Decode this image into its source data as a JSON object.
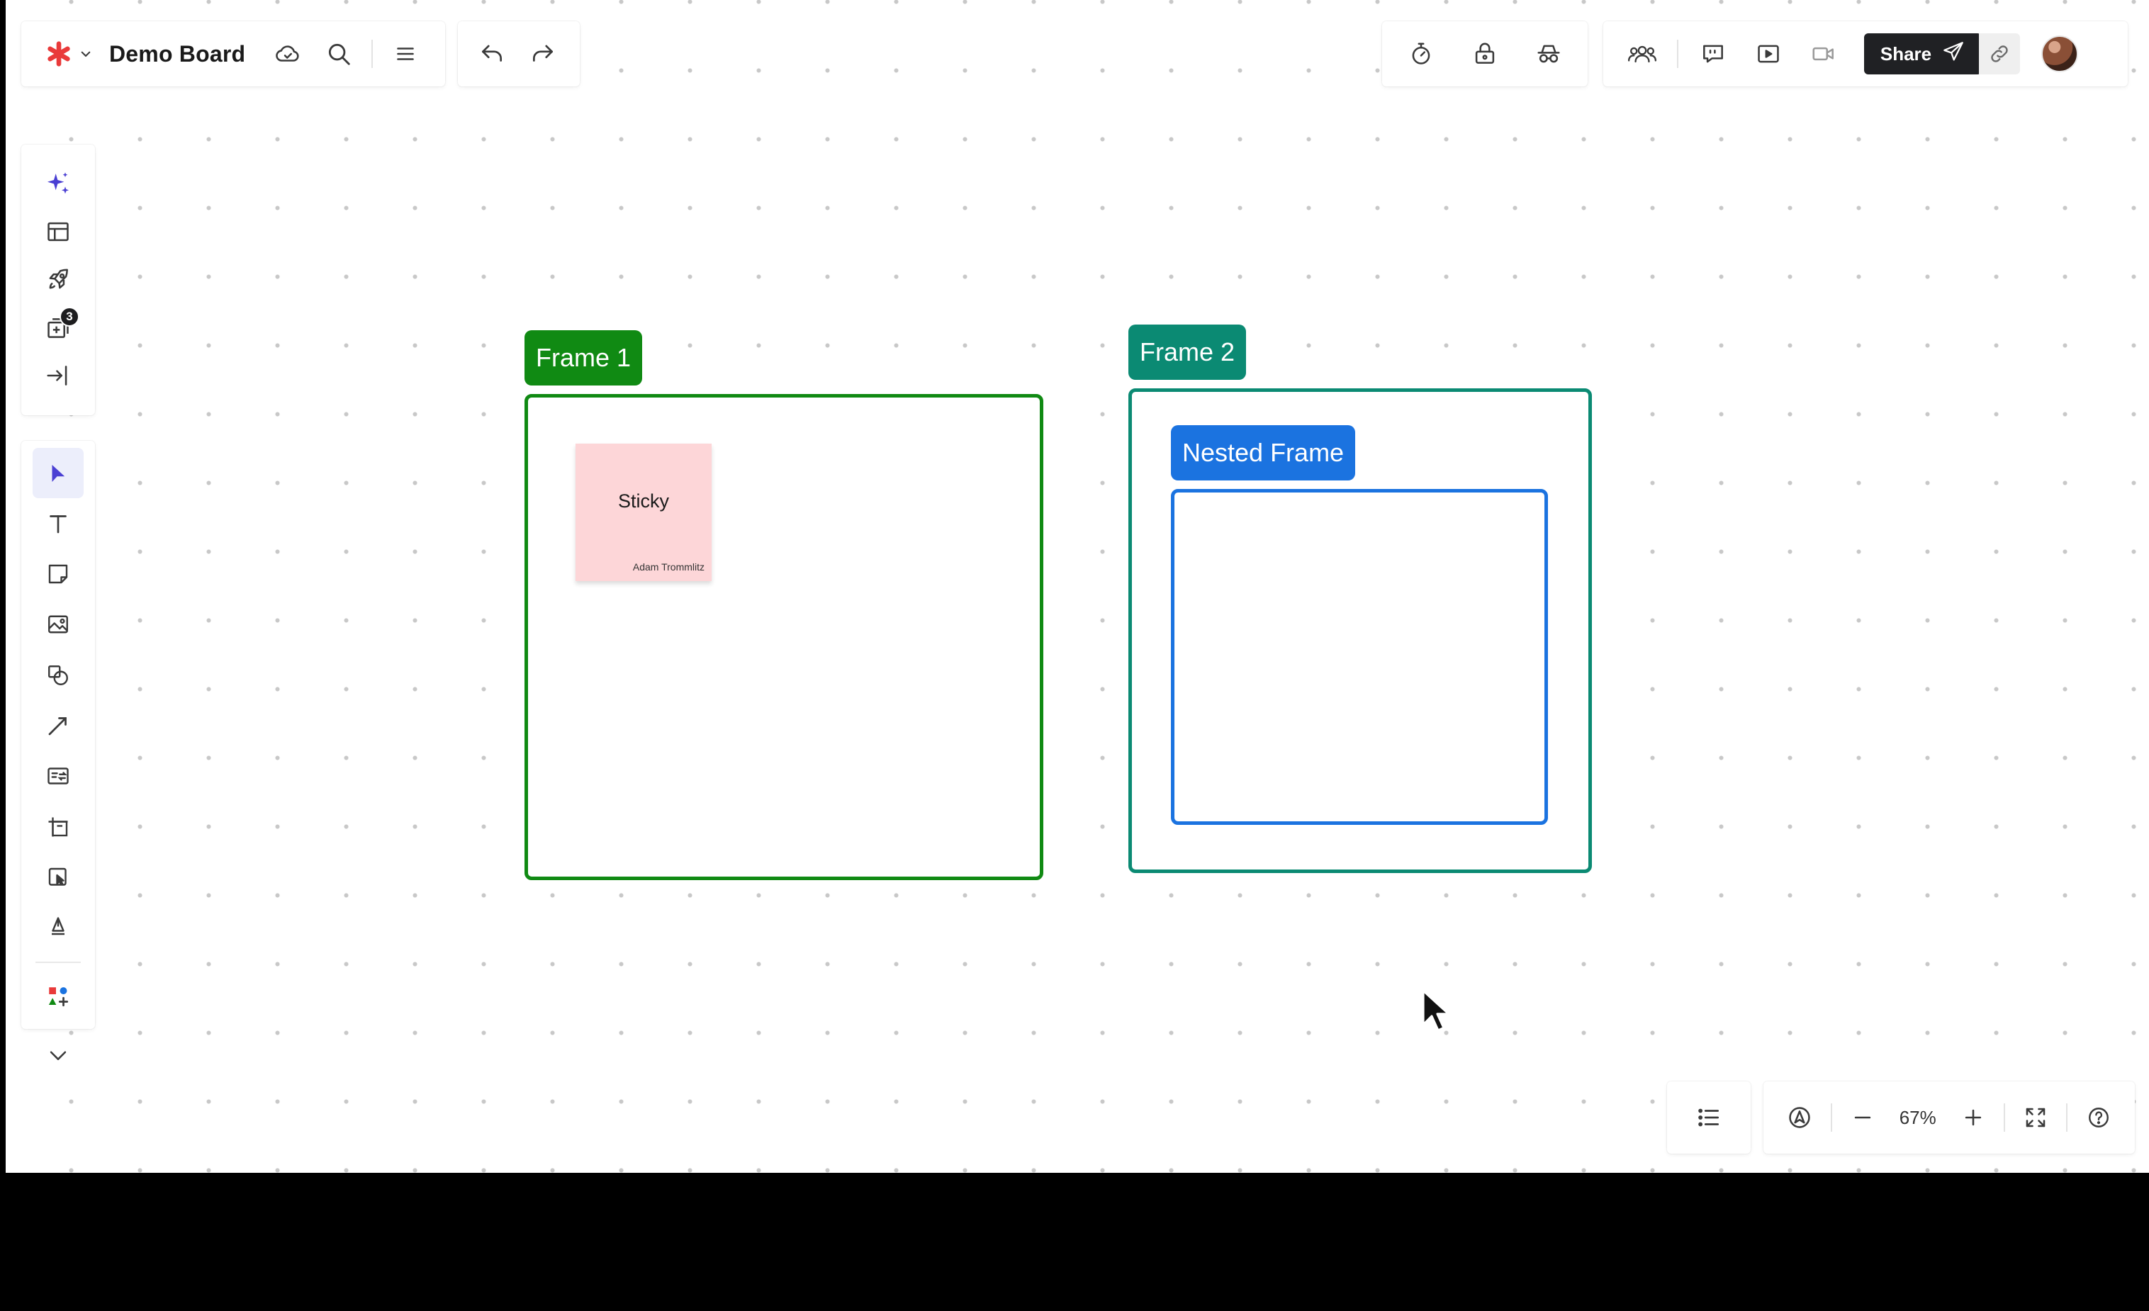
{
  "header": {
    "board_title": "Demo Board",
    "share_label": "Share"
  },
  "sidebar": {
    "templates_badge": "3"
  },
  "canvas": {
    "frame1": {
      "label": "Frame 1",
      "color": "#108a13"
    },
    "frame2": {
      "label": "Frame 2",
      "color": "#0b8a73"
    },
    "nested_frame": {
      "label": "Nested Frame",
      "color": "#1b73e0"
    },
    "sticky": {
      "text": "Sticky",
      "author": "Adam Trommlitz",
      "color": "#fdd6d8"
    }
  },
  "footer": {
    "zoom_level": "67%"
  },
  "colors": {
    "accent": "#e93a3a",
    "ai": "#4a3fd3",
    "share_bg": "#202124"
  }
}
